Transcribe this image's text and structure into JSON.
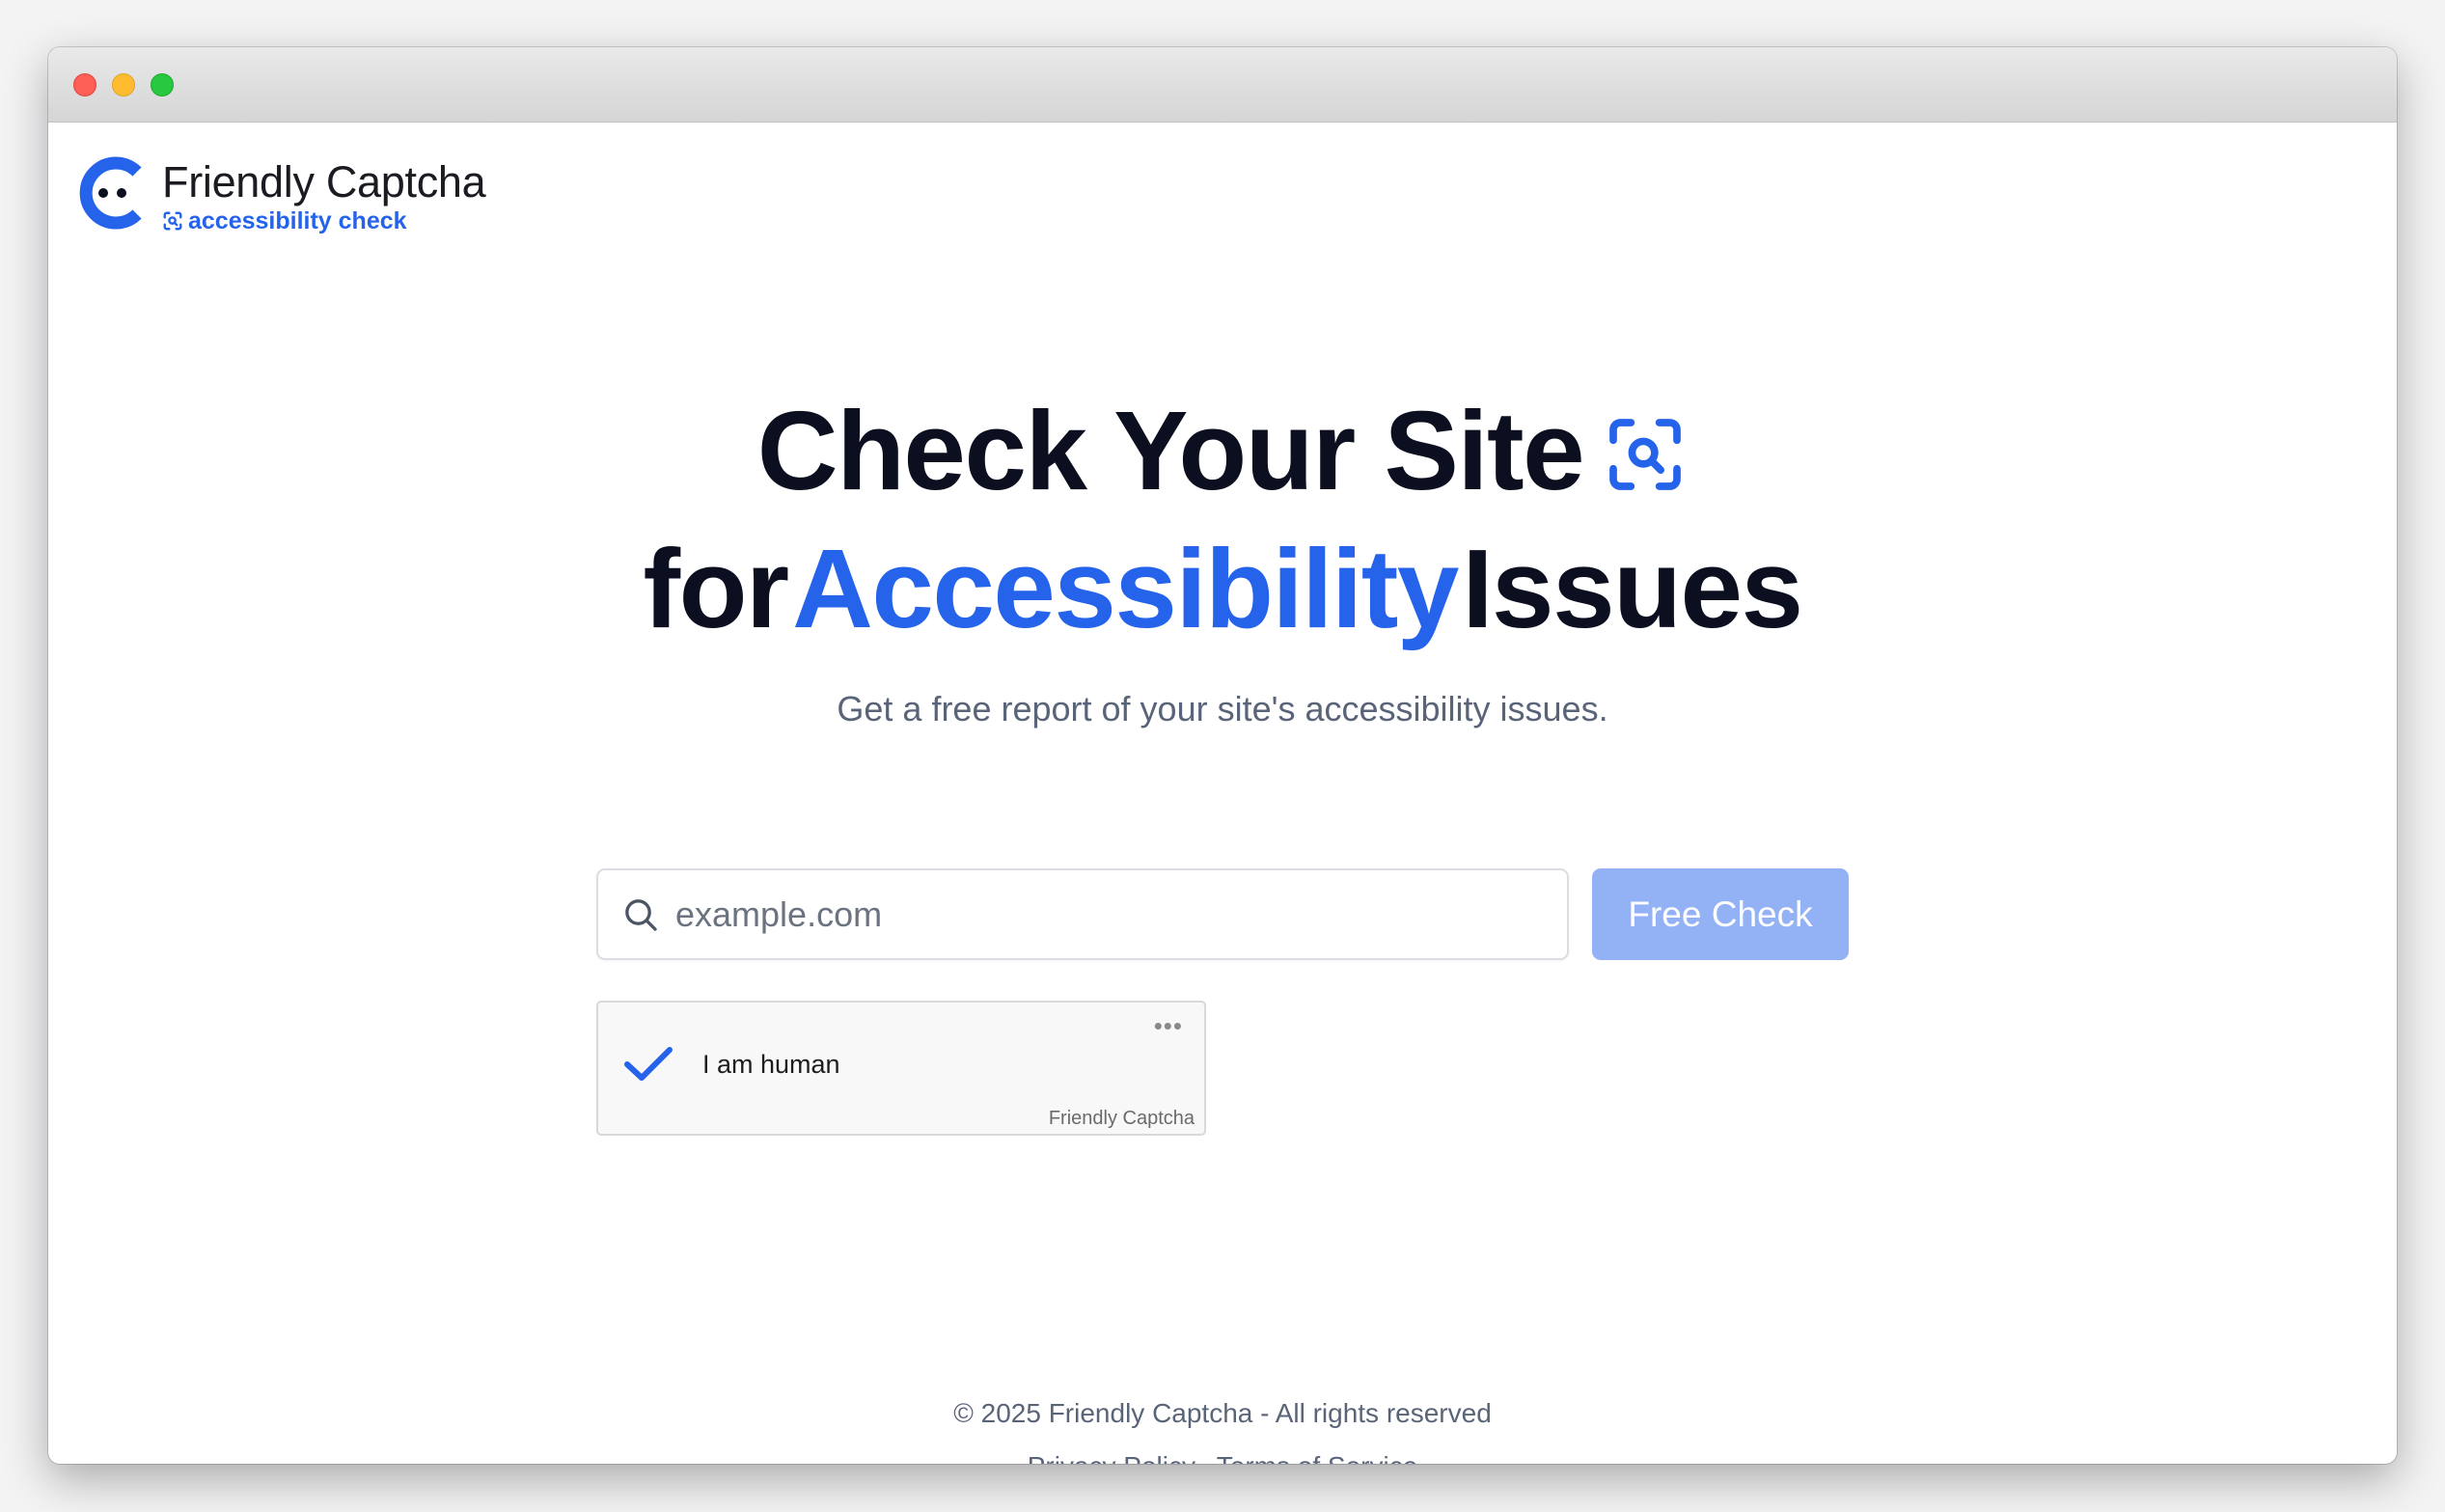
{
  "brand": {
    "name": "Friendly Captcha",
    "product": "accessibility check",
    "accent_color": "#2563eb"
  },
  "hero": {
    "title_line1": "Check Your Site",
    "title_line2_prefix": "for",
    "title_line2_accent": "Accessibility",
    "title_line2_suffix": "Issues",
    "title_icon": "scan-search-icon",
    "subtitle": "Get a free report of your site's accessibility issues."
  },
  "form": {
    "url_placeholder": "example.com",
    "url_value": "",
    "search_icon": "search-icon",
    "submit_label": "Free Check",
    "submit_color": "#93b2f5"
  },
  "captcha": {
    "label": "I am human",
    "status": "verified",
    "status_icon": "checkmark-icon",
    "menu_icon": "more-dots-icon",
    "menu_glyph": "•••",
    "brand": "Friendly Captcha"
  },
  "footer": {
    "copyright": "© 2025 Friendly Captcha - All rights reserved",
    "links": [
      "Privacy Policy",
      "Terms of Service"
    ]
  }
}
